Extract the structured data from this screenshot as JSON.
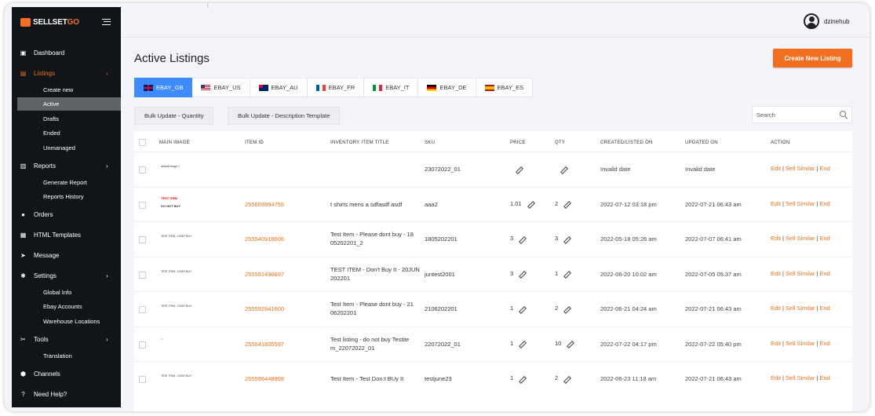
{
  "brand": {
    "logo_part1": "SELLSET",
    "logo_part2": "GO",
    "accent": "#f26f21"
  },
  "sidebar": {
    "items": [
      {
        "label": "Dashboard",
        "icon": "dashboard-icon"
      },
      {
        "label": "Listings",
        "icon": "listings-icon",
        "expanded": true
      },
      {
        "label": "Reports",
        "icon": "reports-icon"
      },
      {
        "label": "Orders",
        "icon": "orders-icon"
      },
      {
        "label": "HTML Templates",
        "icon": "html-templates-icon"
      },
      {
        "label": "Message",
        "icon": "message-icon"
      },
      {
        "label": "Settings",
        "icon": "settings-icon"
      },
      {
        "label": "Tools",
        "icon": "tools-icon"
      },
      {
        "label": "Channels",
        "icon": "channels-icon"
      },
      {
        "label": "Need Help?",
        "icon": "help-icon"
      }
    ],
    "listings_sub": [
      "Create new",
      "Active",
      "Drafts",
      "Ended",
      "Unmanaged"
    ],
    "reports_sub": [
      "Generate Report",
      "Reports History"
    ],
    "settings_sub": [
      "Global Info",
      "Ebay Accounts",
      "Warehouse Locations"
    ],
    "tools_sub": [
      "Translation"
    ]
  },
  "header": {
    "username": "dzinehub"
  },
  "main": {
    "title": "Active Listings",
    "create_button": "Create New Listing",
    "tabs": [
      {
        "label": "EBAY_GB",
        "flag": "gb",
        "active": true
      },
      {
        "label": "EBAY_US",
        "flag": "us"
      },
      {
        "label": "EBAY_AU",
        "flag": "au"
      },
      {
        "label": "EBAY_FR",
        "flag": "fr"
      },
      {
        "label": "EBAY_IT",
        "flag": "it"
      },
      {
        "label": "EBAY_DE",
        "flag": "de"
      },
      {
        "label": "EBAY_ES",
        "flag": "es"
      }
    ],
    "bulk_quantity": "Bulk Update - Quantity",
    "bulk_description": "Bulk Update - Description Template",
    "search_placeholder": "Search"
  },
  "table": {
    "headers": [
      "MAIN IMAGE",
      "ITEM ID",
      "INVENTORY ITEM TITLE",
      "SKU",
      "PRICE",
      "QTY",
      "CREATED/LISTED ON",
      "UPDATED ON",
      "ACTION"
    ],
    "actions": {
      "edit": "Edit",
      "sell_similar": "Sell Similar",
      "end": "End",
      "separator": "|"
    },
    "rows": [
      {
        "thumb": "default image 1",
        "item_id": "",
        "title_1": "",
        "title_2": "",
        "sku": "23072022_01",
        "price": "",
        "qty": "",
        "created": "Invalid date",
        "updated": "Invalid date"
      },
      {
        "thumb_red": "TEST ITEM",
        "thumb_bold": "DO NOT BUY",
        "item_id": "255608994755",
        "title_1": "t shirts mens a sdfasdf asdf",
        "title_2": "",
        "sku": "aaa2",
        "price": "1.01",
        "qty": "2",
        "created": "2022-07-12 03:18 pm",
        "updated": "2022-07-21 06:43 am"
      },
      {
        "thumb": "TEST ITEM - DONT BUY",
        "item_id": "255540918606",
        "title_1": "Test Item - Please dont buy - 18",
        "title_2": "05202201_2",
        "sku": "1805202201",
        "price": "3",
        "qty": "3",
        "created": "2022-05-18 05:26 am",
        "updated": "2022-07-07 06:41 am"
      },
      {
        "thumb": "TEST ITEM - DONT BUY",
        "item_id": "255591496697",
        "title_1": "TEST ITEM - Don't Buy It - 20JUN",
        "title_2": "202201",
        "sku": "juntest2001",
        "price": "3",
        "qty": "1",
        "created": "2022-06-20 10:02 am",
        "updated": "2022-07-05 05:37 am"
      },
      {
        "thumb": "TEST ITEM - DONT BUY",
        "item_id": "255592841600",
        "title_1": "Test Item - Please dont buy - 21",
        "title_2": "06202201",
        "sku": "2106202201",
        "price": "1",
        "qty": "2",
        "created": "2022-06-21 04:24 am",
        "updated": "2022-07-21 06:43 am"
      },
      {
        "thumb": "",
        "item_id": "255641805597",
        "title_1": "Test listing - do not buy Testite",
        "title_2": "m_22072022_01",
        "sku": "22072022_01",
        "price": "1",
        "qty": "10",
        "created": "2022-07-22 04:17 pm",
        "updated": "2022-07-22 05:40 pm"
      },
      {
        "thumb": "TEST ITEM - DONT BUY",
        "item_id": "255596448908",
        "title_1": "Test Item - Test Don:t BUy It",
        "title_2": "",
        "sku": "testjune23",
        "price": "1",
        "qty": "2",
        "created": "2022-06-23 11:18 am",
        "updated": "2022-07-21 06:43 am"
      }
    ]
  }
}
